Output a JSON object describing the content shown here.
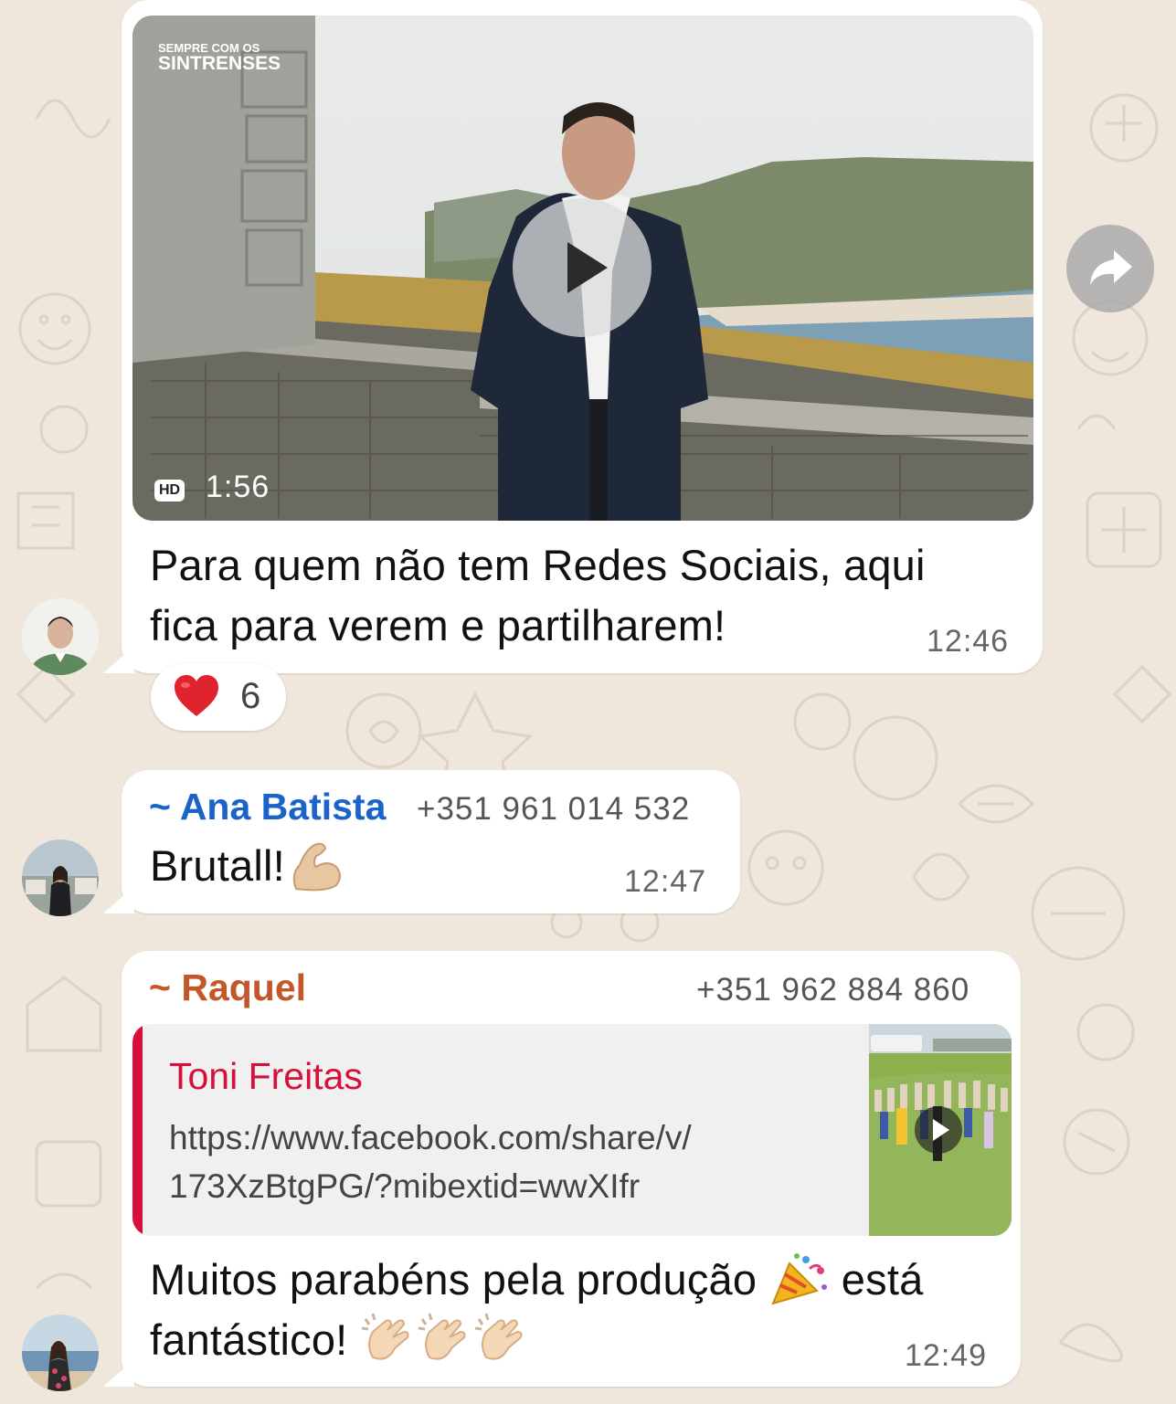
{
  "colors": {
    "wallpaper": "#efe7dc",
    "bubble": "#ffffff",
    "sender_ana": "#1a63c9",
    "sender_raquel": "#c4572a",
    "link_accent": "#d6103a"
  },
  "messages": [
    {
      "video": {
        "overlay_line1": "SEMPRE COM OS",
        "overlay_line2": "SINTRENSES",
        "badge": "HD",
        "duration": "1:56"
      },
      "text_line1": "Para quem não tem Redes Sociais, aqui",
      "text_line2": "fica para verem e partilharem!",
      "time": "12:46",
      "reaction": {
        "emoji": "heart-emoji",
        "count": "6"
      }
    },
    {
      "sender": "~ Ana Batista",
      "phone": "+351 961 014 532",
      "text": "Brutall!",
      "emoji": "flexed-biceps-emoji",
      "time": "12:47"
    },
    {
      "sender": "~ Raquel",
      "phone": "+351 962 884 860",
      "link_preview": {
        "title": "Toni Freitas",
        "url_line1": "https://www.facebook.com/share/v/",
        "url_line2": "173XzBtgPG/?mibextid=wwXIfr"
      },
      "text_line1_a": "Muitos parabéns pela produção",
      "text_line1_b": "está",
      "text_line2": "fantástico!",
      "emojis": [
        "party-popper-emoji",
        "clapping-hands-emoji",
        "clapping-hands-emoji",
        "clapping-hands-emoji"
      ],
      "time": "12:49"
    }
  ]
}
